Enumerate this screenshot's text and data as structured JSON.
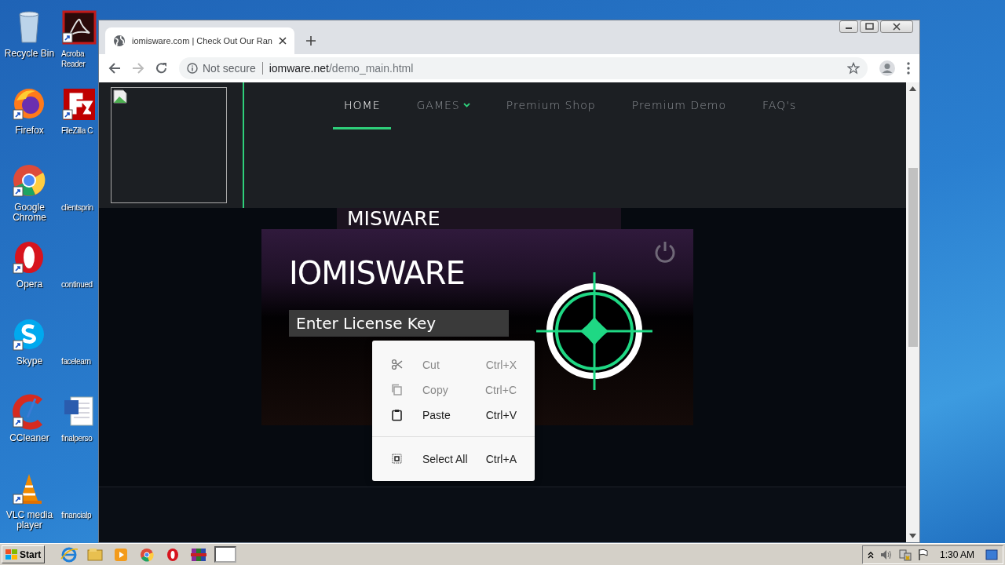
{
  "desktop_icons": [
    {
      "label": "Recycle Bin",
      "kind": "recycle"
    },
    {
      "label": "Firefox",
      "kind": "firefox"
    },
    {
      "label": "Google Chrome",
      "kind": "chrome"
    },
    {
      "label": "Opera",
      "kind": "opera"
    },
    {
      "label": "Skype",
      "kind": "skype"
    },
    {
      "label": "CCleaner",
      "kind": "ccleaner"
    },
    {
      "label": "VLC media player",
      "kind": "vlc"
    },
    {
      "label": "Acroba Reader",
      "kind": "pdf"
    },
    {
      "label": "FileZilla C",
      "kind": "filezilla"
    },
    {
      "label": "clientsprin",
      "kind": "file"
    },
    {
      "label": "continued",
      "kind": "file"
    },
    {
      "label": "facelearn",
      "kind": "file"
    },
    {
      "label": "finalperso",
      "kind": "word"
    },
    {
      "label": "financialp",
      "kind": "file"
    }
  ],
  "browser": {
    "tab": {
      "title": "iomisware.com | Check Out Our Ran"
    },
    "address": {
      "security": "Not secure",
      "domain": "iomware.net",
      "path": "/demo_main.html"
    }
  },
  "nav": [
    {
      "label": "HOME",
      "selected": true,
      "dropdown": false
    },
    {
      "label": "GAMES",
      "selected": false,
      "dropdown": true
    },
    {
      "label": "Premium Shop",
      "selected": false,
      "dropdown": false
    },
    {
      "label": "Premium Demo",
      "selected": false,
      "dropdown": false
    },
    {
      "label": "FAQ's",
      "selected": false,
      "dropdown": false
    }
  ],
  "banner_behind": "MISWARE",
  "card": {
    "title": "IOMISWARE",
    "license_field": {
      "value": "Enter License Key"
    }
  },
  "context_menu": [
    {
      "kind": "cut",
      "label": "Cut",
      "shortcut": "Ctrl+X",
      "disabled": true
    },
    {
      "kind": "copy",
      "label": "Copy",
      "shortcut": "Ctrl+C",
      "disabled": true
    },
    {
      "kind": "paste",
      "label": "Paste",
      "shortcut": "Ctrl+V",
      "disabled": false
    },
    {
      "kind": "separator"
    },
    {
      "kind": "select_all",
      "label": "Select All",
      "shortcut": "Ctrl+A",
      "disabled": false
    }
  ],
  "taskbar": {
    "start": "Start",
    "clock": "1:30 AM"
  }
}
